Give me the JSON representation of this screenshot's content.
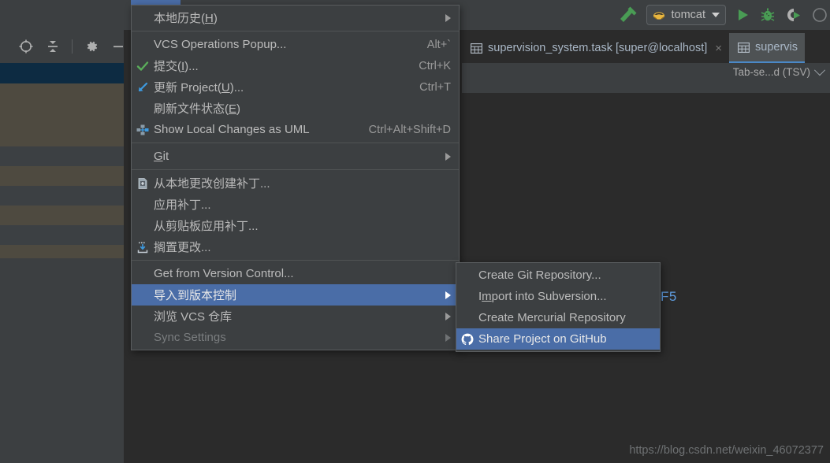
{
  "toolbar": {
    "build_icon": "hammer-icon",
    "run_config_name": "tomcat",
    "run_config_icon": "tomcat-icon",
    "run_label": "run-icon",
    "debug_label": "debug-icon",
    "run_with_coverage_label": "run-with-coverage-icon",
    "more_label": "more-icon"
  },
  "left_panel": {
    "locate_icon": "locate-data-source-icon",
    "collapse_icon": "collapse-all-icon",
    "settings_icon": "gear-icon",
    "hide_icon": "minimize-icon",
    "close_icon": "close-icon"
  },
  "editor_tabs": [
    {
      "icon": "table-grid-icon",
      "label": "supervision_system.task [super@localhost]",
      "close": "×",
      "active": false
    },
    {
      "icon": "table-grid-icon",
      "label": "supervis",
      "close": "",
      "active": true
    }
  ],
  "editor": {
    "separator_format": "Tab-se...d (TSV)",
    "chevron": "chevron-down-icon",
    "code_fragment": "F5"
  },
  "vcs_menu": {
    "items": [
      {
        "id": "local-history",
        "icon": null,
        "label_pre": "本地历史(",
        "mnemonic": "H",
        "label_post": ")",
        "accel": "",
        "arrow": true,
        "state": "normal"
      },
      {
        "id": "separator-1",
        "type": "separator"
      },
      {
        "id": "vcs-operations-popup",
        "icon": null,
        "label_pre": "VCS Operations Popup...",
        "mnemonic": "",
        "label_post": "",
        "accel": "Alt+`",
        "arrow": false,
        "state": "normal"
      },
      {
        "id": "commit",
        "icon": "green-check-icon",
        "label_pre": "提交(",
        "mnemonic": "I",
        "label_post": ")...",
        "accel": "Ctrl+K",
        "arrow": false,
        "state": "normal"
      },
      {
        "id": "update-project",
        "icon": "blue-update-icon",
        "label_pre": "更新 Project(",
        "mnemonic": "U",
        "label_post": ")...",
        "accel": "Ctrl+T",
        "arrow": false,
        "state": "normal"
      },
      {
        "id": "refresh-file-status",
        "icon": null,
        "label_pre": "刷新文件状态(",
        "mnemonic": "E",
        "label_post": ")",
        "accel": "",
        "arrow": false,
        "state": "normal"
      },
      {
        "id": "show-local-changes-uml",
        "icon": "uml-diagram-icon",
        "label_pre": "Show Local Changes as UML",
        "mnemonic": "",
        "label_post": "",
        "accel": "Ctrl+Alt+Shift+D",
        "arrow": false,
        "state": "normal"
      },
      {
        "id": "separator-2",
        "type": "separator"
      },
      {
        "id": "git",
        "icon": null,
        "label_pre": "",
        "mnemonic": "G",
        "label_post": "it",
        "accel": "",
        "arrow": true,
        "state": "normal"
      },
      {
        "id": "separator-3",
        "type": "separator"
      },
      {
        "id": "create-patch",
        "icon": "create-patch-icon",
        "label_pre": "从本地更改创建补丁...",
        "mnemonic": "",
        "label_post": "",
        "accel": "",
        "arrow": false,
        "state": "normal"
      },
      {
        "id": "apply-patch",
        "icon": null,
        "label_pre": "应用补丁...",
        "mnemonic": "",
        "label_post": "",
        "accel": "",
        "arrow": false,
        "state": "normal"
      },
      {
        "id": "apply-patch-clipboard",
        "icon": null,
        "label_pre": "从剪贴板应用补丁...",
        "mnemonic": "",
        "label_post": "",
        "accel": "",
        "arrow": false,
        "state": "normal"
      },
      {
        "id": "shelve-changes",
        "icon": "shelve-changes-icon",
        "label_pre": "搁置更改...",
        "mnemonic": "",
        "label_post": "",
        "accel": "",
        "arrow": false,
        "state": "normal"
      },
      {
        "id": "separator-4",
        "type": "separator"
      },
      {
        "id": "get-from-version-control",
        "icon": null,
        "label_pre": "Get from Version Control...",
        "mnemonic": "",
        "label_post": "",
        "accel": "",
        "arrow": false,
        "state": "normal"
      },
      {
        "id": "import-into-version-control",
        "icon": null,
        "label_pre": "导入到版本控制",
        "mnemonic": "",
        "label_post": "",
        "accel": "",
        "arrow": true,
        "state": "selected"
      },
      {
        "id": "browse-vcs-repository",
        "icon": null,
        "label_pre": "浏览 VCS 仓库",
        "mnemonic": "",
        "label_post": "",
        "accel": "",
        "arrow": true,
        "state": "normal"
      },
      {
        "id": "sync-settings",
        "icon": null,
        "label_pre": "Sync Settings",
        "mnemonic": "",
        "label_post": "",
        "accel": "",
        "arrow": true,
        "state": "disabled"
      }
    ]
  },
  "vcs_submenu": {
    "items": [
      {
        "id": "create-git-repository",
        "icon": null,
        "label_pre": "Create Git Repository...",
        "mnemonic": "",
        "label_post": "",
        "state": "normal"
      },
      {
        "id": "import-into-subversion",
        "icon": null,
        "label_pre": "I",
        "mnemonic": "m",
        "label_post": "port into Subversion...",
        "state": "normal"
      },
      {
        "id": "create-mercurial-repository",
        "icon": null,
        "label_pre": "Create Mercurial Repository",
        "mnemonic": "",
        "label_post": "",
        "state": "normal"
      },
      {
        "id": "share-project-on-github",
        "icon": "github-icon",
        "label_pre": "Share Project on GitHub",
        "mnemonic": "",
        "label_post": "",
        "state": "selected"
      }
    ]
  },
  "watermark": {
    "text": "https://blog.csdn.net/weixin_46072377"
  },
  "colors": {
    "menu_bg": "#3c3f41",
    "menu_border": "#5a5d5f",
    "selection_blue": "#4a6da7",
    "text": "#bbbbbb",
    "accel_text": "#9a9a9a",
    "disabled_text": "#7a7d7f",
    "editor_bg": "#2b2b2b",
    "data_stripe_warm": "#4e4a40",
    "data_stripe_cool": "#3c4043",
    "selected_row": "#0d2b42",
    "green_accent": "#499c54",
    "blue_code": "#5f9de0"
  }
}
